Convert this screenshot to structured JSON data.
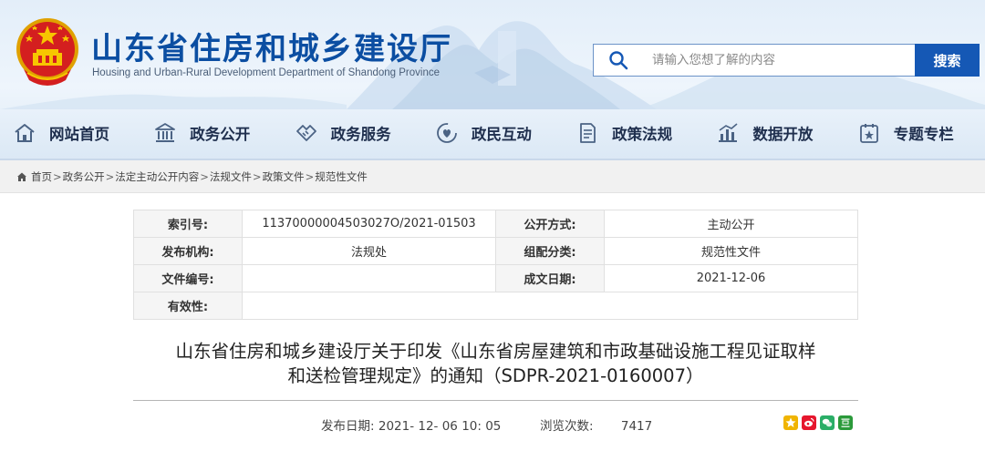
{
  "header": {
    "title": "山东省住房和城乡建设厅",
    "subtitle": "Housing and Urban-Rural Development Department of Shandong Province",
    "search_placeholder": "请输入您想了解的内容",
    "search_button_label": "搜索"
  },
  "nav": [
    {
      "label": "网站首页",
      "icon": "home-icon"
    },
    {
      "label": "政务公开",
      "icon": "government-building-icon"
    },
    {
      "label": "政务服务",
      "icon": "handshake-icon"
    },
    {
      "label": "政民互动",
      "icon": "interaction-heart-icon"
    },
    {
      "label": "政策法规",
      "icon": "policy-document-icon"
    },
    {
      "label": "数据开放",
      "icon": "bar-chart-icon"
    },
    {
      "label": "专题专栏",
      "icon": "special-topic-icon"
    }
  ],
  "breadcrumb": [
    "首页",
    "政务公开",
    "法定主动公开内容",
    "法规文件",
    "政策文件",
    "规范性文件"
  ],
  "breadcrumb_separator": ">",
  "info": {
    "index_label": "索引号:",
    "index_value": "11370000004503027O/2021-01503",
    "disclosure_label": "公开方式:",
    "disclosure_value": "主动公开",
    "issuer_label": "发布机构:",
    "issuer_value": "法规处",
    "category_label": "组配分类:",
    "category_value": "规范性文件",
    "doc_number_label": "文件编号:",
    "doc_number_value": "",
    "date_label": "成文日期:",
    "date_value": "2021-12-06",
    "validity_label": "有效性:",
    "validity_value": ""
  },
  "article": {
    "title_line1": "山东省住房和城乡建设厅关于印发《山东省房屋建筑和市政基础设施工程见证取样",
    "title_line2": "和送检管理规定》的通知（SDPR-2021-0160007）",
    "publish_label": "发布日期:",
    "publish_value": "2021- 12- 06 10: 05",
    "views_label": "浏览次数:",
    "views_value": "7417"
  },
  "share_icons": [
    "qzone-icon",
    "weibo-icon",
    "wechat-icon",
    "douban-icon"
  ],
  "colors": {
    "brand_blue": "#0b4ea2",
    "search_button": "#1558b5",
    "nav_text": "#1f2f4e"
  }
}
